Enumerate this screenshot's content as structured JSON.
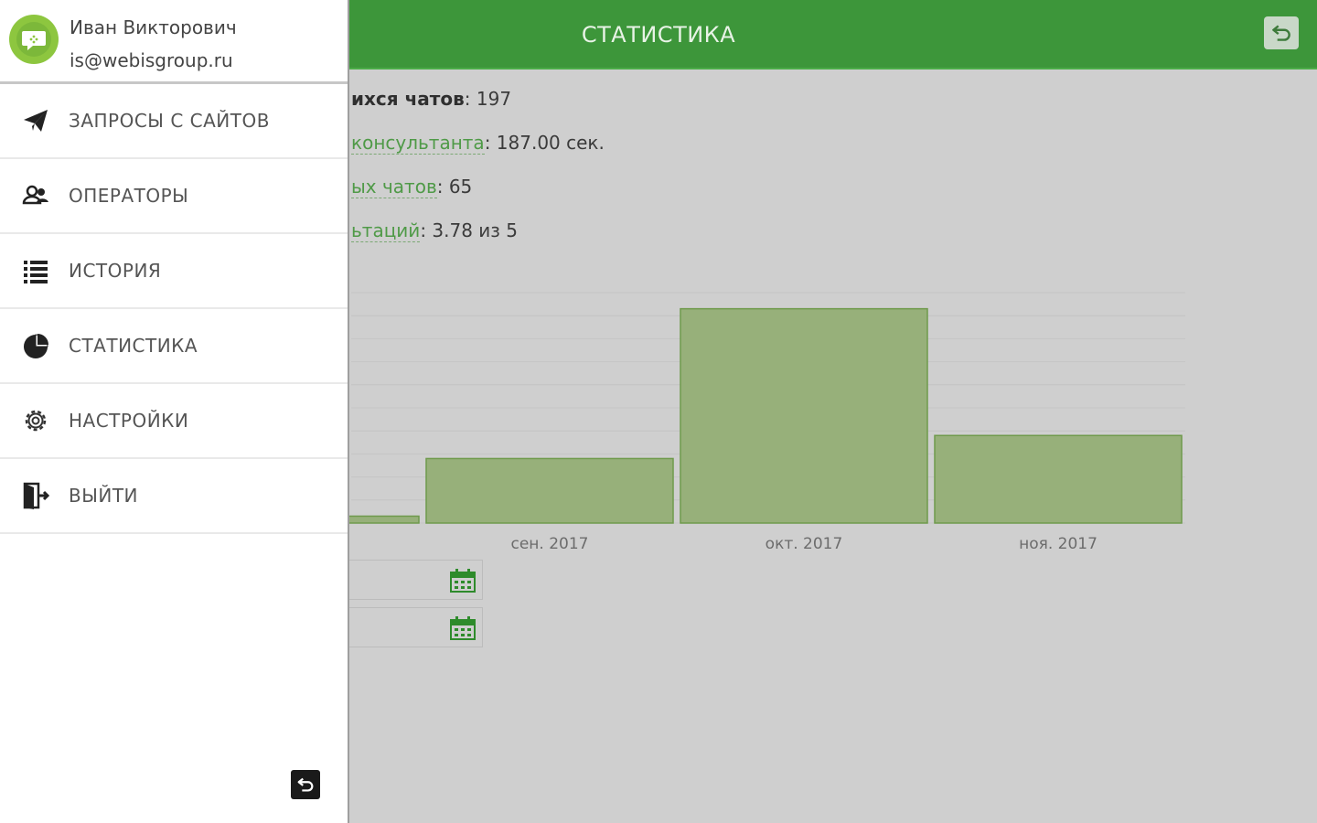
{
  "appbar": {
    "title": "СТАТИСТИКА"
  },
  "stats": [
    {
      "label": "ихся чатов",
      "value": ": 197",
      "style": "strong"
    },
    {
      "label": "консультанта",
      "value": ": 187.00 сек.",
      "style": "link"
    },
    {
      "label": "ых чатов",
      "value": ": 65",
      "style": "link"
    },
    {
      "label": "ьтаций",
      "value": ": 3.78 из 5",
      "style": "link"
    }
  ],
  "chart_data": {
    "type": "bar",
    "categories": [
      "",
      "сен. 2017",
      "окт. 2017",
      "ноя. 2017"
    ],
    "values": [
      3,
      28,
      93,
      38
    ],
    "ylim": [
      0,
      100
    ],
    "grid": true,
    "title": "",
    "xlabel": "",
    "ylabel": ""
  },
  "drawer": {
    "user_name": "Иван Викторович",
    "user_email": "is@webisgroup.ru",
    "items": [
      {
        "label": "ЗАПРОСЫ С САЙТОВ",
        "icon": "paper-plane-icon"
      },
      {
        "label": "ОПЕРАТОРЫ",
        "icon": "users-icon"
      },
      {
        "label": "ИСТОРИЯ",
        "icon": "list-icon"
      },
      {
        "label": "СТАТИСТИКА",
        "icon": "pie-chart-icon"
      },
      {
        "label": "НАСТРОЙКИ",
        "icon": "gear-icon"
      },
      {
        "label": "ВЫЙТИ",
        "icon": "exit-icon"
      }
    ]
  },
  "colors": {
    "accent": "#3d963a",
    "bar": "#97b07a",
    "avatar": "#8dc63f"
  }
}
